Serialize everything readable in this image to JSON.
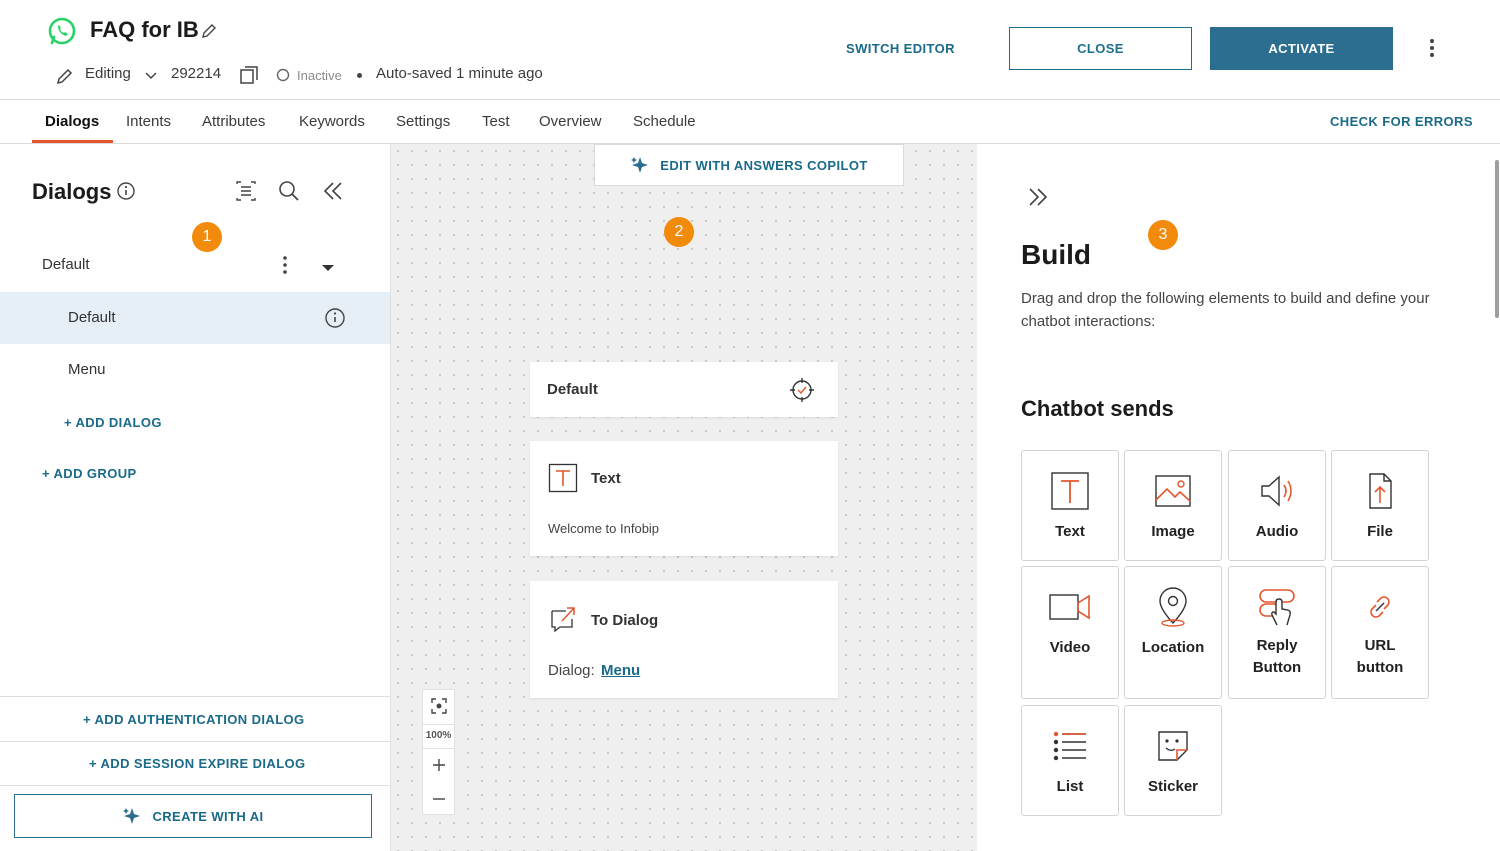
{
  "header": {
    "title": "FAQ for IB",
    "mode": "Editing",
    "bot_id": "292214",
    "status": "Inactive",
    "autosave": "Auto-saved 1 minute ago",
    "switch_editor": "SWITCH EDITOR",
    "close": "CLOSE",
    "activate": "ACTIVATE"
  },
  "tabs": [
    "Dialogs",
    "Intents",
    "Attributes",
    "Keywords",
    "Settings",
    "Test",
    "Overview",
    "Schedule"
  ],
  "check_errors": "CHECK FOR ERRORS",
  "left_panel": {
    "title": "Dialogs",
    "group": "Default",
    "dialogs": [
      "Default",
      "Menu"
    ],
    "add_dialog": "+ ADD DIALOG",
    "add_group": "+ ADD GROUP",
    "add_auth": "+ ADD AUTHENTICATION DIALOG",
    "add_session": "+ ADD SESSION EXPIRE DIALOG",
    "create_ai": "CREATE WITH AI"
  },
  "badges": [
    "1",
    "2",
    "3"
  ],
  "canvas": {
    "copilot": "EDIT WITH ANSWERS COPILOT",
    "card_default": "Default",
    "text_title": "Text",
    "text_body": "Welcome to Infobip",
    "todialog_title": "To Dialog",
    "dialog_label": "Dialog:",
    "dialog_link": "Menu",
    "zoom": "100%"
  },
  "build": {
    "title": "Build",
    "desc": "Drag and drop the following elements to build and define your chatbot interactions:",
    "section": "Chatbot sends",
    "tiles": [
      "Text",
      "Image",
      "Audio",
      "File",
      "Video",
      "Location",
      "Reply Button",
      "URL button",
      "List",
      "Sticker"
    ]
  },
  "colors": {
    "accent": "#2b6e8f",
    "orange": "#f28a0c",
    "tab_underline": "#e4572e",
    "whatsapp": "#25d366"
  }
}
